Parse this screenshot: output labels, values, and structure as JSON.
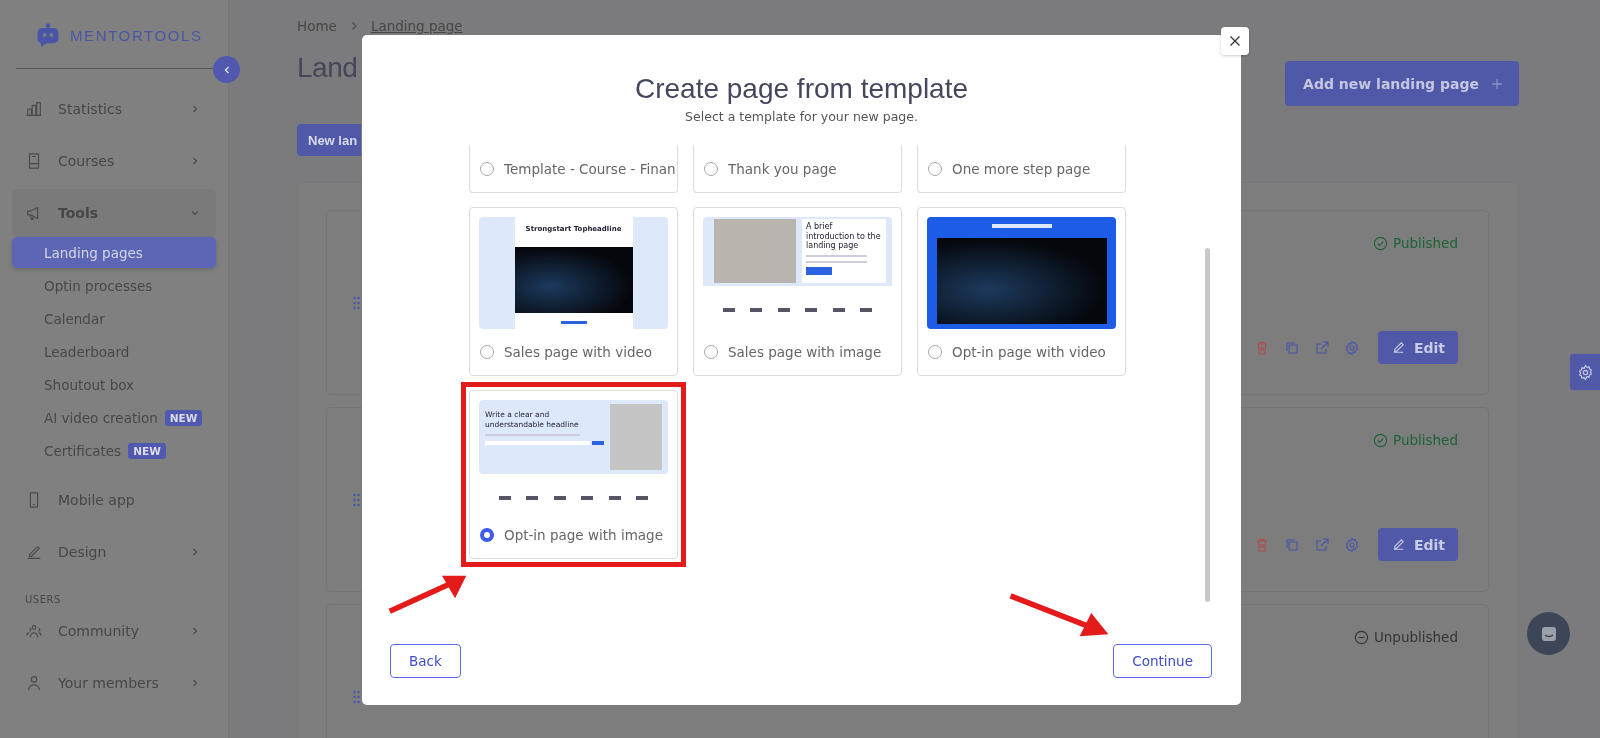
{
  "sidebar": {
    "logo": "MENTORTOOLS",
    "items": [
      {
        "kind": "group",
        "label": "Statistics",
        "expanded": false
      },
      {
        "kind": "group",
        "label": "Courses",
        "expanded": false
      },
      {
        "kind": "group",
        "label": "Tools",
        "expanded": true,
        "children": [
          {
            "label": "Landing pages",
            "selected": true
          },
          {
            "label": "Optin processes",
            "selected": false
          },
          {
            "label": "Calendar",
            "selected": false
          },
          {
            "label": "Leaderboard",
            "selected": false
          },
          {
            "label": "Shoutout box",
            "selected": false
          },
          {
            "label": "AI video creation",
            "selected": false,
            "badge": "NEW"
          },
          {
            "label": "Certificates",
            "selected": false,
            "badge": "NEW"
          }
        ]
      },
      {
        "kind": "link",
        "label": "Mobile app"
      },
      {
        "kind": "group",
        "label": "Design",
        "expanded": false
      },
      {
        "kind": "section",
        "label": "USERS"
      },
      {
        "kind": "group",
        "label": "Community",
        "expanded": false
      },
      {
        "kind": "group",
        "label": "Your members",
        "expanded": false
      }
    ]
  },
  "breadcrumb": [
    "Home",
    "Landing page"
  ],
  "page_title": "Land",
  "add_button": "Add new landing page",
  "new_button": "New lan",
  "landing_pages": [
    {
      "status": "Published",
      "published": true,
      "edit": "Edit"
    },
    {
      "status": "Published",
      "published": true,
      "edit": "Edit"
    },
    {
      "status": "Unpublished",
      "published": false
    }
  ],
  "modal": {
    "title": "Create page from template",
    "subtitle": "Select a template for your new page.",
    "templates": [
      {
        "kind": "scrolled",
        "label": "Template - Course - Finan",
        "selected": false
      },
      {
        "kind": "scrolled",
        "label": "Thank you page",
        "selected": false
      },
      {
        "kind": "scrolled",
        "label": "One more step page",
        "selected": false
      },
      {
        "kind": "salesvideo",
        "label": "Sales page with video",
        "selected": false,
        "preview_headline": "Strongstart Topheadline"
      },
      {
        "kind": "salesimage",
        "label": "Sales page with image",
        "selected": false,
        "preview_headline": "A brief introduction to the landing page"
      },
      {
        "kind": "optinvideo",
        "label": "Opt-in page with video",
        "selected": false
      },
      {
        "kind": "optinimage",
        "label": "Opt-in page with image",
        "selected": true,
        "preview_headline": "Write a clear and understandable headline"
      }
    ],
    "back": "Back",
    "continue": "Continue"
  }
}
